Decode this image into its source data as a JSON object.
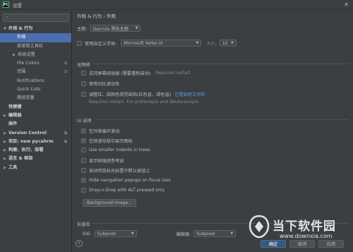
{
  "window": {
    "title": "设置",
    "app_icon_text": "PC",
    "close_glyph": "✕"
  },
  "sidebar": {
    "search_glyph": "⌕",
    "items": [
      {
        "label": "外观 & 行为",
        "arrow": "▼"
      },
      {
        "label": "外观"
      },
      {
        "label": "菜单和工具栏"
      },
      {
        "label": "系统设置",
        "arrow": "▶"
      },
      {
        "label": "File Colors",
        "icon": "⧉"
      },
      {
        "label": "范围",
        "icon": "⧉"
      },
      {
        "label": "Notifications"
      },
      {
        "label": "Quick Lists"
      },
      {
        "label": "路径变量"
      },
      {
        "label": "快捷键"
      },
      {
        "label": "编辑器",
        "arrow": "▶"
      },
      {
        "label": "插件"
      },
      {
        "label": "Version Control",
        "arrow": "▶",
        "icon": "⧉"
      },
      {
        "label": "项目: new pycahrm",
        "arrow": "▶",
        "icon": "⧉"
      },
      {
        "label": "构建、执行、部署",
        "arrow": "▶"
      },
      {
        "label": "语言 & 框架",
        "arrow": "▶"
      },
      {
        "label": "工具",
        "arrow": "▶"
      }
    ]
  },
  "main": {
    "breadcrumb": "外观 & 行为  ›  外观",
    "theme": {
      "label": "主题:",
      "value": "Darcula 黑色主题"
    },
    "custom_font": {
      "label": "使用自定义字体:",
      "font_value": "Microsoft YaHei UI",
      "size_label": "大小:",
      "size_value": "12"
    },
    "accessibility": {
      "title": "无障碍",
      "screen_reader": "支持屏幕阅读器 (需要重新启动)",
      "requires_restart": "Requires restart",
      "contrast_scrollbars": "使用对比滚动条",
      "color_deficiency": "调整红、绿颜色视觉缺陷(红色盲、绿色盲)",
      "how_it_works": "它是如何工作的",
      "restart_note": "Requires restart. For protanopia and deuteranopia"
    },
    "ui_options": {
      "title": "UI 选项",
      "cyclic_scrolling": "在列表循环滚动",
      "show_icons_quick_nav": "在快速导航中显示图标",
      "smaller_indents": "Use smaller indents in trees",
      "show_tree_indent_guides": "显示树缩进参考线",
      "move_mouse_default_button": "自动将鼠标光标置于默认按钮上",
      "hide_navigation_popups": "Hide navigation popups on focus loss",
      "drag_n_drop_alt": "Drag-n-Drop with ALT pressed only",
      "background_image_button": "Background Image..."
    },
    "antialiasing": {
      "title": "抗锯齿",
      "ide_label": "IDE:",
      "ide_value": "Subpixel",
      "editor_label": "编辑器:",
      "editor_value": "Subpixel"
    }
  },
  "buttons": {
    "ok": "确定",
    "cancel": "取消",
    "apply": "应用",
    "help": "?"
  },
  "watermark": {
    "text": "当下软件园",
    "url": "www.downxia.com"
  },
  "colors": {
    "selection": "#4b6eaf",
    "link": "#589df6",
    "background": "#3c3f41"
  }
}
